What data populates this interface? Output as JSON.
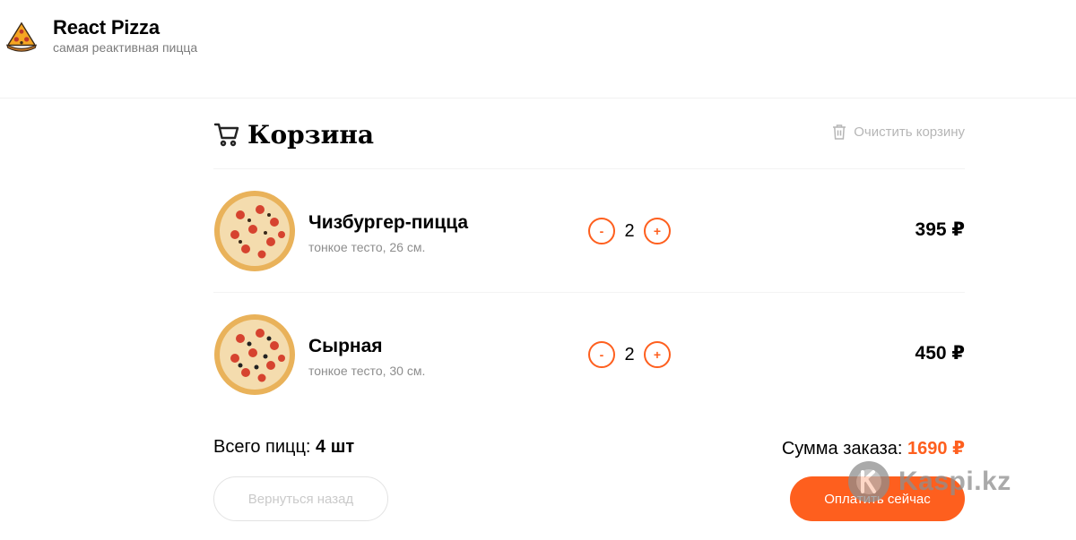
{
  "header": {
    "title": "React Pizza",
    "subtitle": "самая реактивная пицца"
  },
  "cart": {
    "title": "Корзина",
    "clear_label": "Очистить корзину",
    "items": [
      {
        "name": "Чизбургер-пицца",
        "desc": "тонкое тесто, 26 см.",
        "count": "2",
        "price": "395 ₽",
        "minus": "-",
        "plus": "+"
      },
      {
        "name": "Сырная",
        "desc": "тонкое тесто, 30 см.",
        "count": "2",
        "price": "450 ₽",
        "minus": "-",
        "plus": "+"
      }
    ],
    "total_count_label": "Всего пицц:",
    "total_count_value": "4 шт",
    "total_sum_label": "Сумма заказа:",
    "total_sum_value": "1690 ₽",
    "back_label": "Вернуться назад",
    "pay_label": "Оплатить сейчас"
  },
  "watermark": {
    "text": "Kaspi.kz"
  },
  "colors": {
    "accent": "#fe5f1e",
    "muted": "#b6b6b6"
  },
  "icons": [
    "pizza-logo-icon",
    "cart-icon",
    "trash-icon",
    "pizza-image",
    "kaspi-logo-icon"
  ]
}
